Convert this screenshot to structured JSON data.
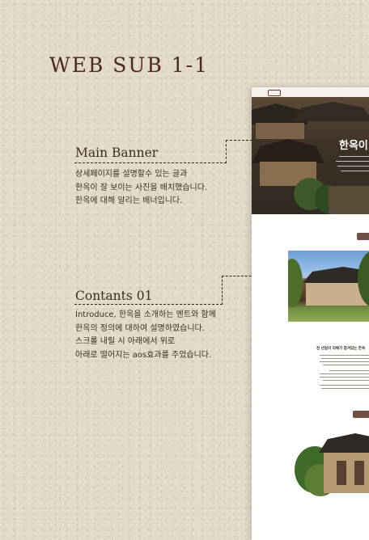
{
  "page_title": "WEB SUB 1-1",
  "sections": [
    {
      "heading": "Main Banner",
      "lines": [
        "상세페이지를 설명할수 있는 글과",
        "한옥이 잘 보이는 사진을 배치했습니다.",
        "한옥에 대해 알리는 배너입니다."
      ]
    },
    {
      "heading": "Contants 01",
      "lines": [
        "Introduce, 한옥을 소개하는 멘트와 함께",
        "한옥의  정의에 대하여  설명하였습니다.",
        "스크롤 내릴 시 아래에서 위로",
        "아래로 떨어지는 aos효과를 주었습니다."
      ]
    }
  ],
  "mockup": {
    "banner_title": "한옥이",
    "content_heading": "천 년일의 리베가 참겨있는 한옥"
  },
  "colors": {
    "background": "#e2d9c6",
    "title": "#4b2a1c",
    "text": "#3e2f22",
    "badge": "#6d4f43"
  }
}
